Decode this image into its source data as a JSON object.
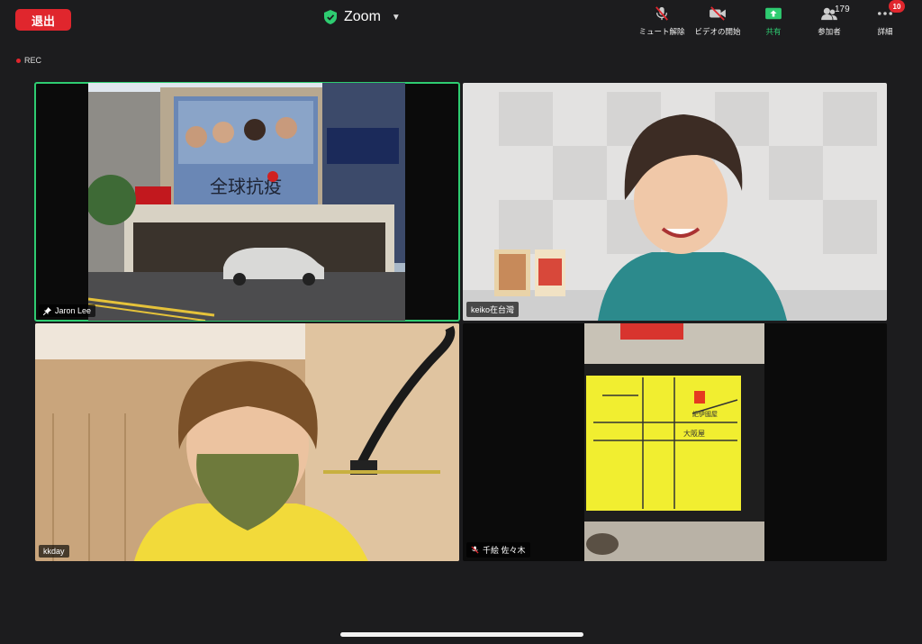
{
  "header": {
    "leave_label": "退出",
    "app_title": "Zoom",
    "rec_label": "REC"
  },
  "toolbar": {
    "mute_label": "ミュート解除",
    "video_label": "ビデオの開始",
    "share_label": "共有",
    "participants_label": "参加者",
    "participants_count": "179",
    "more_label": "詳細",
    "more_badge": "10"
  },
  "participants": [
    {
      "name": "Jaron Lee",
      "icon": "pin-icon"
    },
    {
      "name": "keiko在台灣",
      "icon": ""
    },
    {
      "name": "kkday",
      "icon": ""
    },
    {
      "name": "千絵 佐々木",
      "icon": "mic-muted-icon"
    }
  ],
  "scene": {
    "banner_text": "全球抗疫",
    "map_label_1": "大阪屋",
    "map_label_2": "紀伊國屋"
  },
  "colors": {
    "leave": "#e0262d",
    "active_speaker": "#2ecc71",
    "share": "#2ecc71",
    "background": "#1c1c1e"
  }
}
